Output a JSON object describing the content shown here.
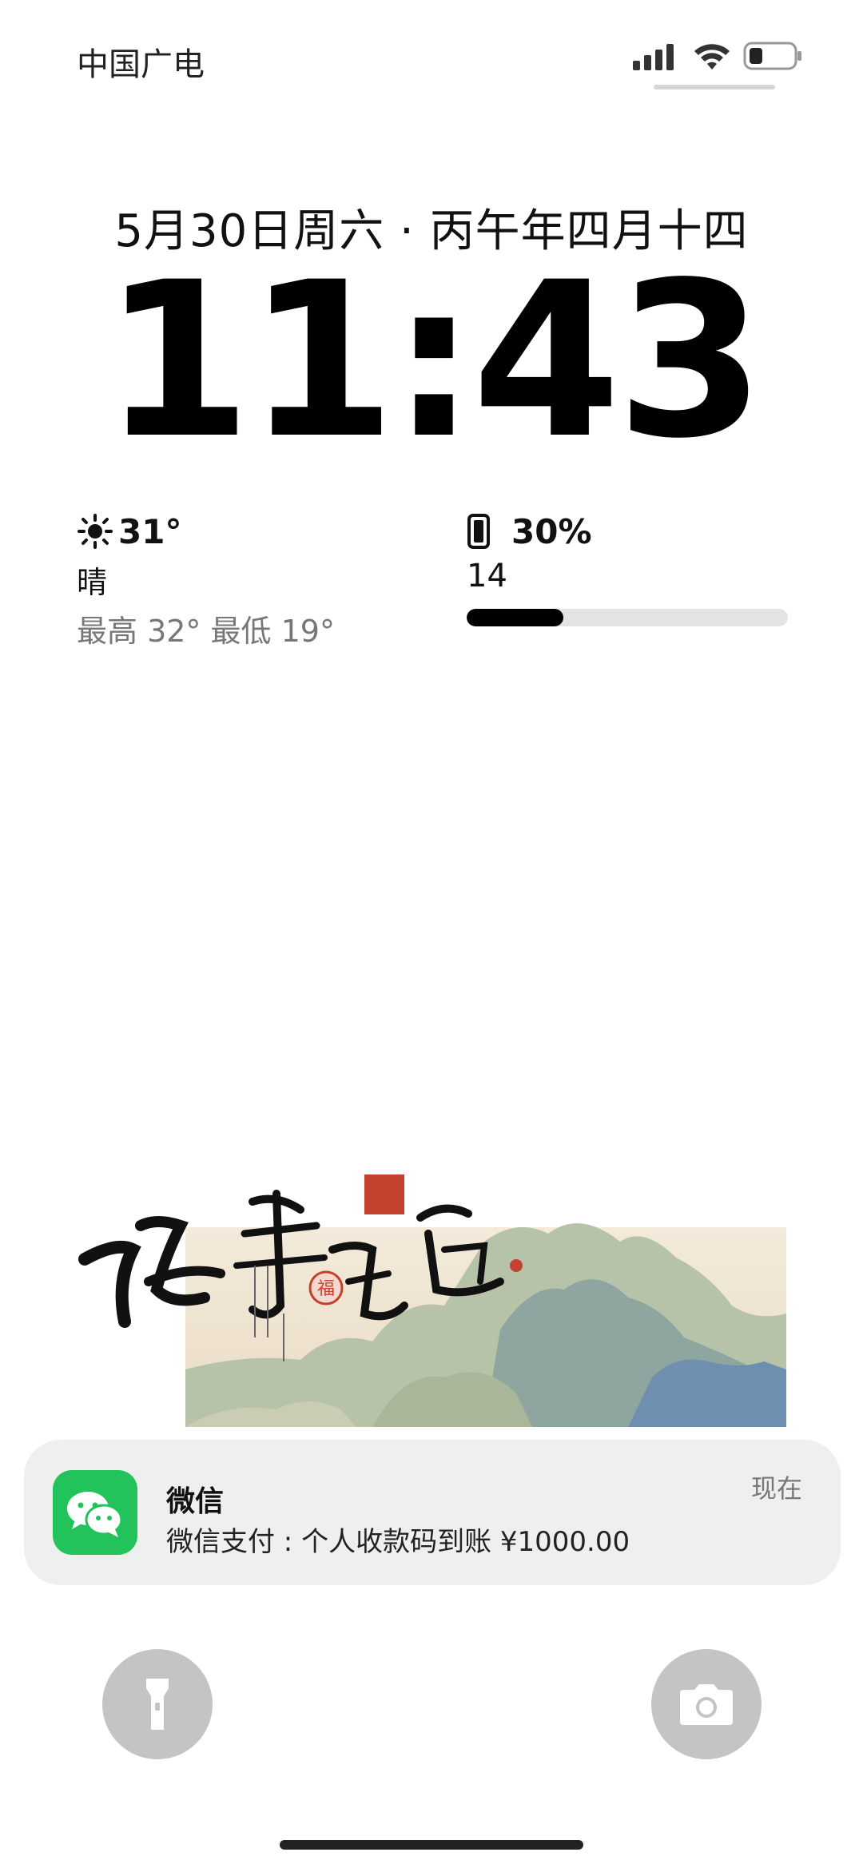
{
  "status_bar": {
    "carrier": "中国广电",
    "icons": [
      "signal-icon",
      "wifi-icon",
      "battery-icon"
    ]
  },
  "lock_screen": {
    "date": "5月30日周六 · 丙午年四月十四",
    "time": "11:43"
  },
  "weather_widget": {
    "icon": "sun-icon",
    "temperature": "31°",
    "condition": "晴",
    "range": "最高 32° 最低 19°"
  },
  "battery_widget": {
    "icon": "phone-icon",
    "percent": "30%",
    "device": "14",
    "level": 0.3
  },
  "banner": {
    "calligraphy": "诸事皆宜",
    "seal_text": "福"
  },
  "notification": {
    "app": "微信",
    "message": "微信支付 : 个人收款码到账 ¥1000.00",
    "time": "现在",
    "icon": "wechat-icon",
    "accent": "#23c35b"
  },
  "bottom_controls": {
    "left": "flashlight-icon",
    "right": "camera-icon"
  }
}
